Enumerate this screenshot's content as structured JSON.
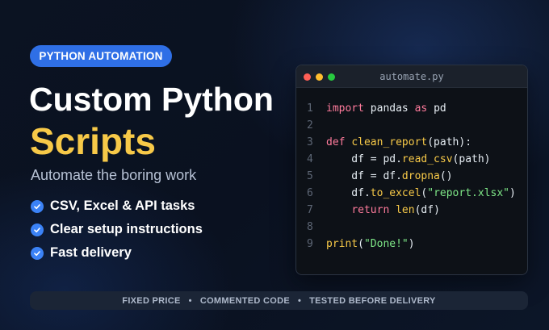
{
  "badge": "PYTHON AUTOMATION",
  "title_line1": "Custom Python",
  "title_line2": "Scripts",
  "subtitle": "Automate the boring work",
  "features": [
    "CSV, Excel & API tasks",
    "Clear setup instructions",
    "Fast delivery"
  ],
  "editor": {
    "filename": "automate.py",
    "lines": [
      {
        "n": "1",
        "tokens": [
          {
            "t": "import",
            "c": "kw"
          },
          {
            "t": " pandas ",
            "c": ""
          },
          {
            "t": "as",
            "c": "kw"
          },
          {
            "t": " pd",
            "c": ""
          }
        ]
      },
      {
        "n": "2",
        "tokens": []
      },
      {
        "n": "3",
        "tokens": [
          {
            "t": "def",
            "c": "kw"
          },
          {
            "t": " ",
            "c": ""
          },
          {
            "t": "clean_report",
            "c": "fn"
          },
          {
            "t": "(path):",
            "c": ""
          }
        ]
      },
      {
        "n": "4",
        "tokens": [
          {
            "t": "    df = pd.",
            "c": ""
          },
          {
            "t": "read_csv",
            "c": "fn"
          },
          {
            "t": "(path)",
            "c": ""
          }
        ]
      },
      {
        "n": "5",
        "tokens": [
          {
            "t": "    df = df.",
            "c": ""
          },
          {
            "t": "dropna",
            "c": "fn"
          },
          {
            "t": "()",
            "c": ""
          }
        ]
      },
      {
        "n": "6",
        "tokens": [
          {
            "t": "    df.",
            "c": ""
          },
          {
            "t": "to_excel",
            "c": "fn"
          },
          {
            "t": "(",
            "c": ""
          },
          {
            "t": "\"report.xlsx\"",
            "c": "str"
          },
          {
            "t": ")",
            "c": ""
          }
        ]
      },
      {
        "n": "7",
        "tokens": [
          {
            "t": "    ",
            "c": ""
          },
          {
            "t": "return",
            "c": "kw"
          },
          {
            "t": " ",
            "c": ""
          },
          {
            "t": "len",
            "c": "fn"
          },
          {
            "t": "(df)",
            "c": ""
          }
        ]
      },
      {
        "n": "8",
        "tokens": []
      },
      {
        "n": "9",
        "tokens": [
          {
            "t": "print",
            "c": "fn"
          },
          {
            "t": "(",
            "c": ""
          },
          {
            "t": "\"Done!\"",
            "c": "str"
          },
          {
            "t": ")",
            "c": ""
          }
        ]
      }
    ]
  },
  "bottom": {
    "item1": "FIXED PRICE",
    "item2": "COMMENTED CODE",
    "item3": "TESTED BEFORE DELIVERY",
    "separator": "•"
  },
  "colors": {
    "accent": "#2f6fe6",
    "highlight": "#f7c948",
    "check": "#3b82f6",
    "keyword": "#ff7b9c",
    "string": "#7ee787"
  }
}
